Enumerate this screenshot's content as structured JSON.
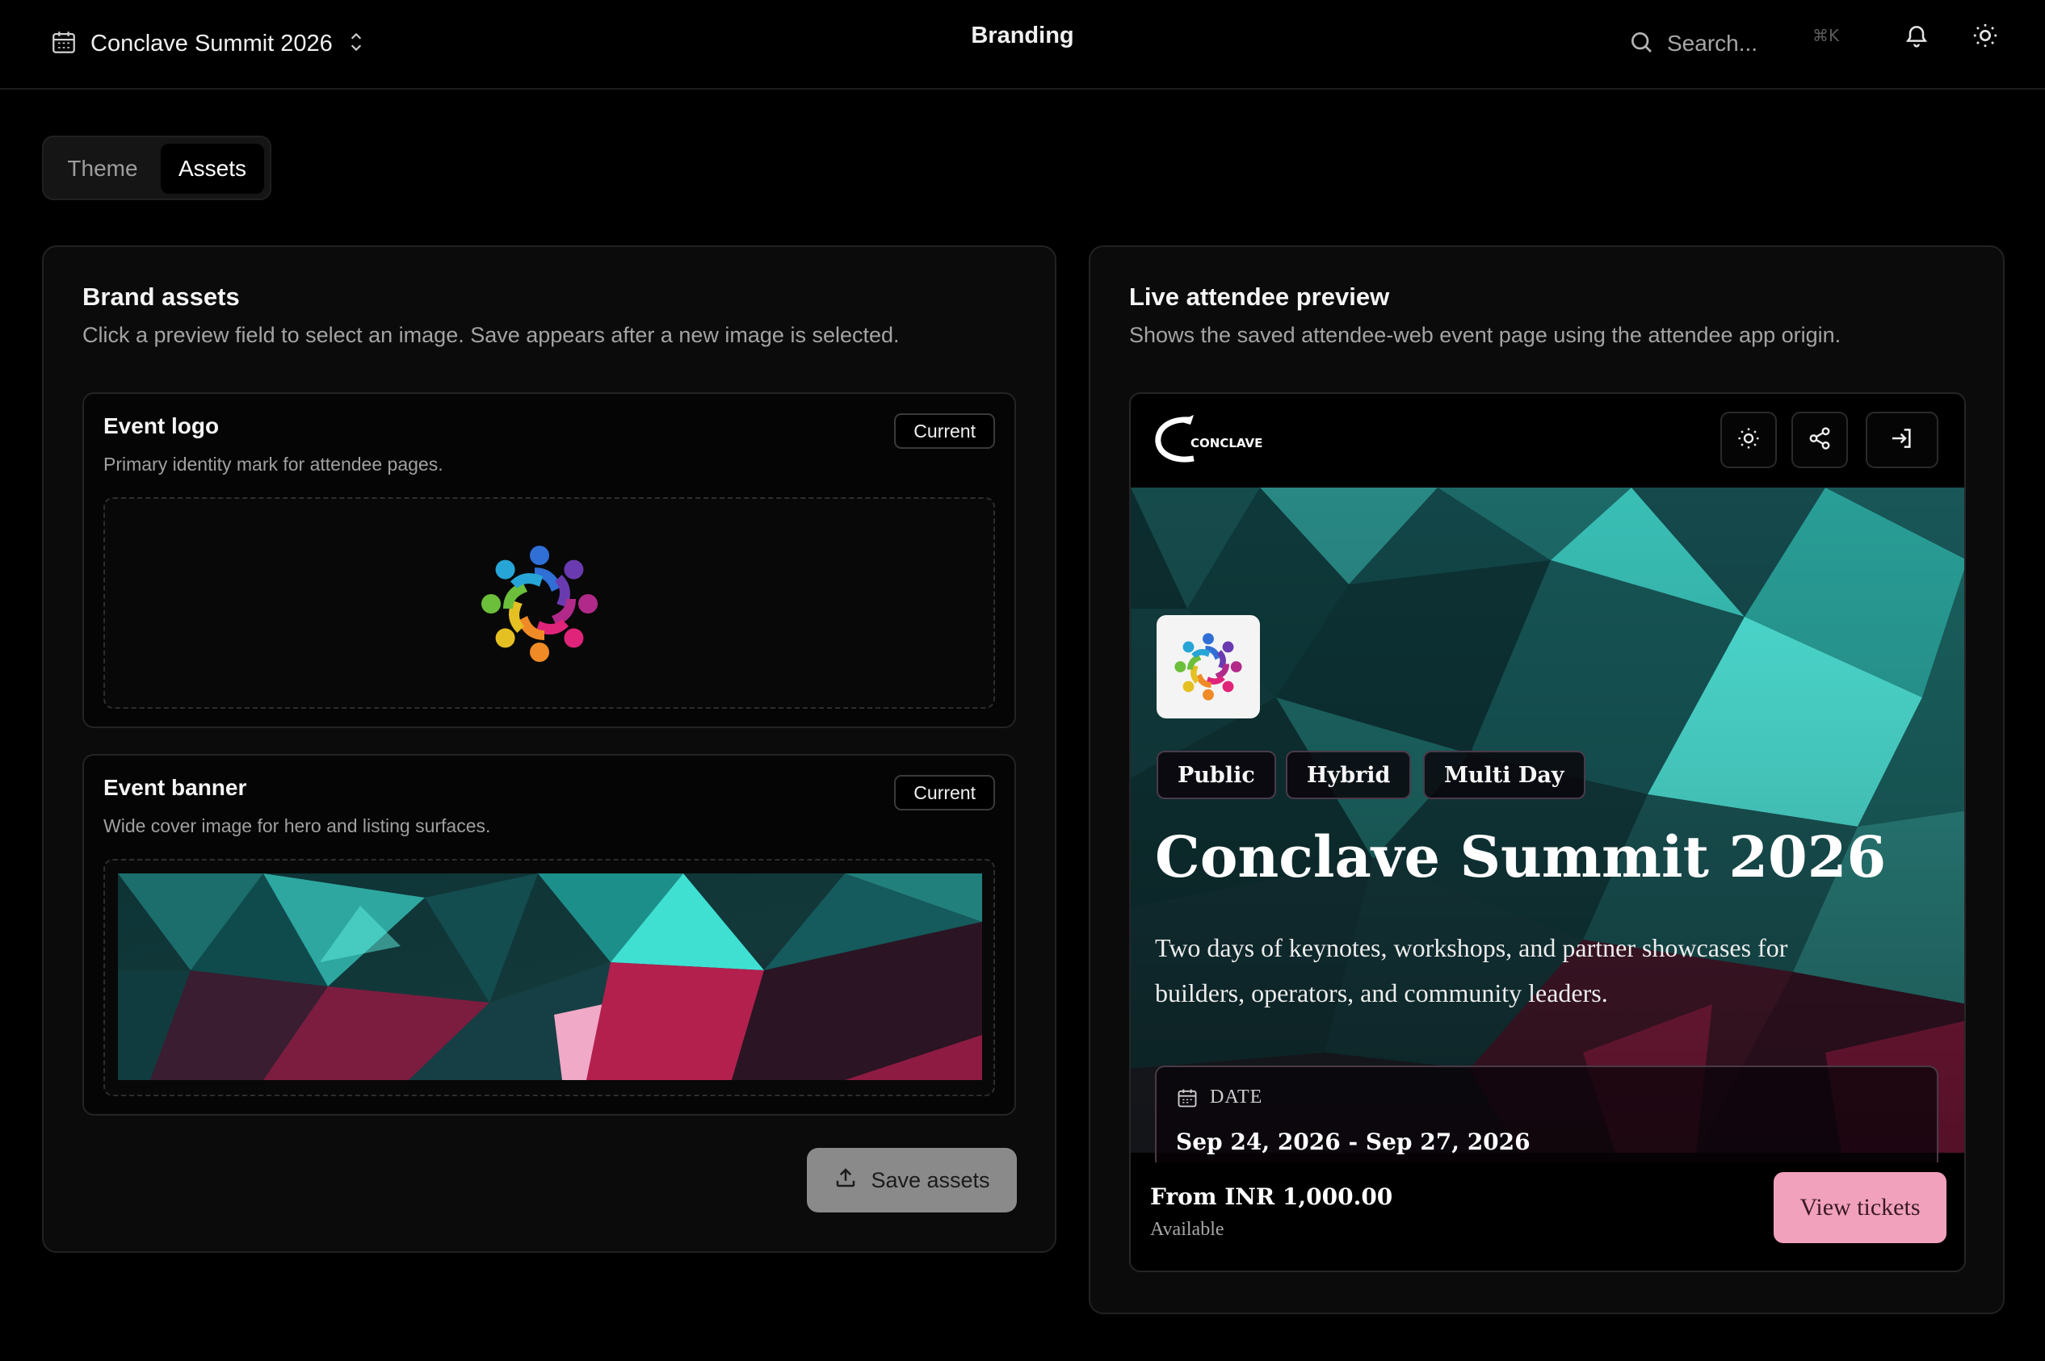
{
  "topbar": {
    "event_name": "Conclave Summit 2026",
    "page_title": "Branding",
    "search_placeholder": "Search...",
    "shortcut": "⌘K"
  },
  "tabs": [
    {
      "label": "Theme",
      "active": false
    },
    {
      "label": "Assets",
      "active": true
    }
  ],
  "brand_assets": {
    "title": "Brand assets",
    "description": "Click a preview field to select an image. Save appears after a new image is selected.",
    "logo": {
      "title": "Event logo",
      "description": "Primary identity mark for attendee pages.",
      "badge": "Current"
    },
    "banner": {
      "title": "Event banner",
      "description": "Wide cover image for hero and listing surfaces.",
      "badge": "Current"
    },
    "save_label": "Save assets"
  },
  "live_preview": {
    "title": "Live attendee preview",
    "description": "Shows the saved attendee-web event page using the attendee app origin.",
    "brand_logo": "CONCLAVE",
    "tags": [
      "Public",
      "Hybrid",
      "Multi Day"
    ],
    "event_title": "Conclave Summit 2026",
    "event_description": "Two days of keynotes, workshops, and partner showcases for builders, operators, and community leaders.",
    "date_label": "DATE",
    "date_value": "Sep 24, 2026 - Sep 27, 2026",
    "price": "From INR 1,000.00",
    "availability": "Available",
    "cta_label": "View tickets"
  },
  "colors": {
    "background": "#000000",
    "panel": "#0b0b0b",
    "accent_pink": "#f2a1bd",
    "banner_teal": "#1f8f8a",
    "banner_magenta": "#b3204e"
  }
}
